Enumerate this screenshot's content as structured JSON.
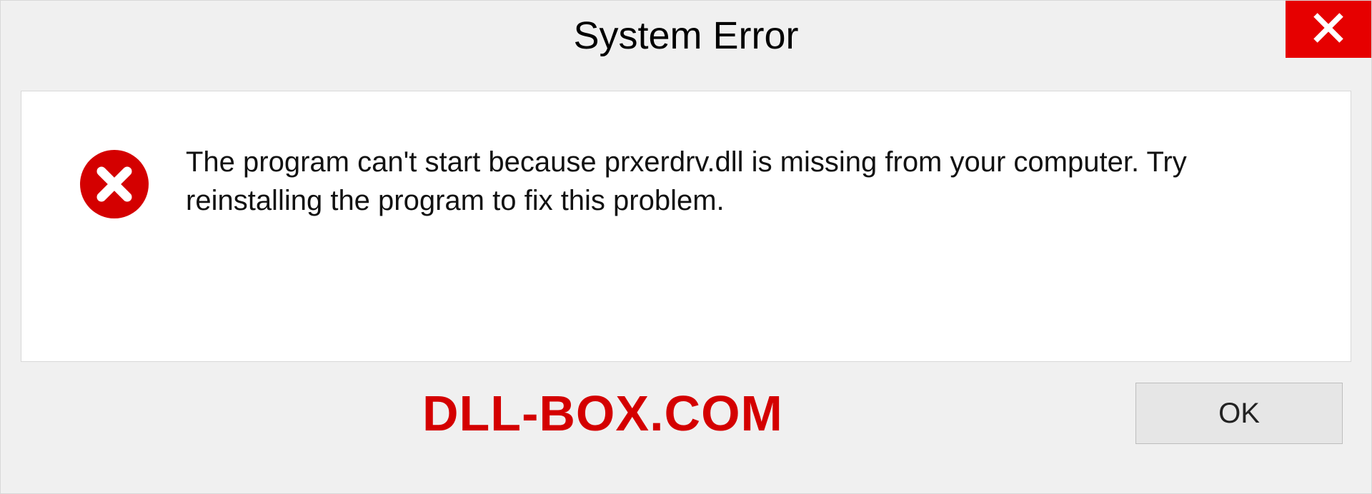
{
  "titlebar": {
    "title": "System Error"
  },
  "content": {
    "message": "The program can't start because prxerdrv.dll is missing from your computer. Try reinstalling the program to fix this problem."
  },
  "footer": {
    "watermark": "DLL-BOX.COM",
    "ok_label": "OK"
  },
  "colors": {
    "close_bg": "#e60000",
    "error_red": "#d40000",
    "dialog_bg": "#f0f0f0"
  }
}
